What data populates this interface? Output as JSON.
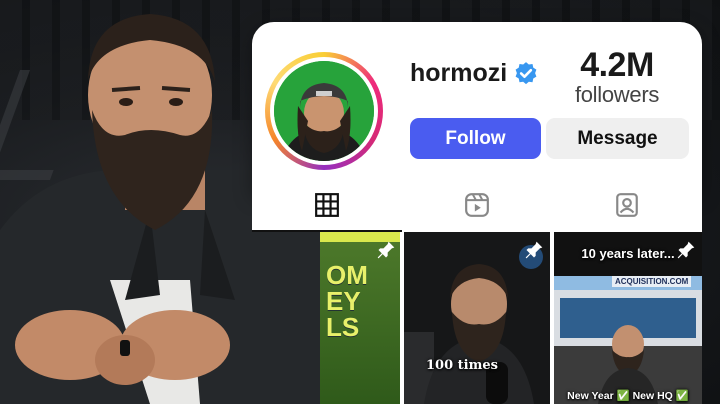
{
  "profile": {
    "username": "hormozi",
    "verified": true,
    "followers_count": "4.2M",
    "followers_label": "followers",
    "follow_label": "Follow",
    "message_label": "Message"
  },
  "tabs": [
    {
      "icon": "grid-icon",
      "active": true
    },
    {
      "icon": "reels-icon",
      "active": false
    },
    {
      "icon": "tagged-icon",
      "active": false
    }
  ],
  "posts": [
    {
      "caption": "",
      "pinned": true
    },
    {
      "caption": "100 times",
      "pinned": true
    },
    {
      "caption_top": "10 years later...",
      "sign": "ACQUISITION.COM",
      "caption_bottom_1": "New Year ✅",
      "caption_bottom_2": "New HQ ✅",
      "pinned": true
    }
  ],
  "colors": {
    "follow_button": "#4a5cf0",
    "message_button": "#efefef",
    "verified_badge": "#3897f0",
    "avatar_background": "#27a33b"
  }
}
